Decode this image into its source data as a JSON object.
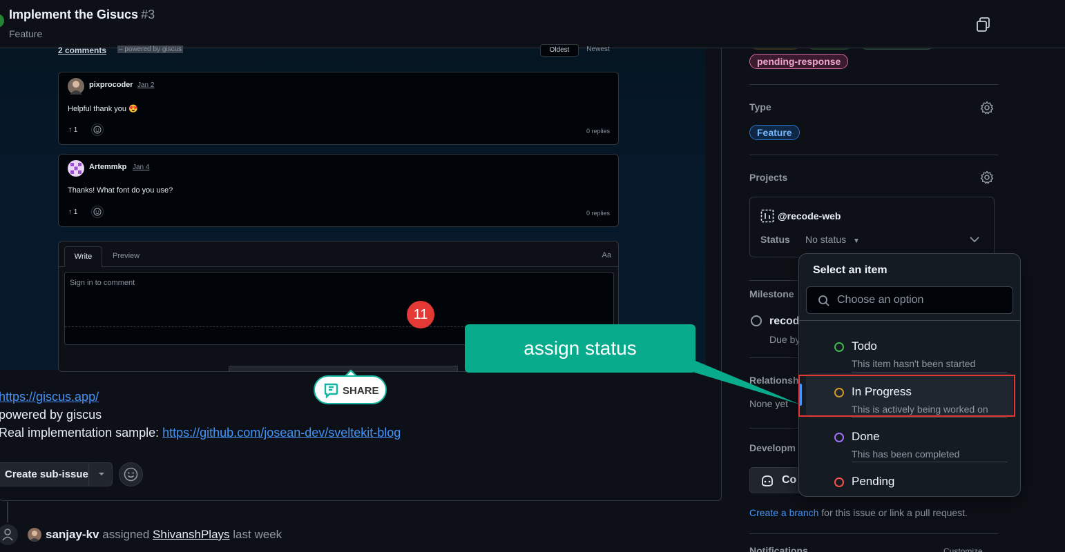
{
  "header": {
    "title": "Implement the Gisucs",
    "number": "#3",
    "type": "Feature"
  },
  "giscus": {
    "comments_count": "2 comments",
    "powered": "– powered by giscus",
    "sort_oldest": "Oldest",
    "sort_newest": "Newest",
    "comments": [
      {
        "author": "pixprocoder",
        "date": "Jan 2",
        "body": "Helpful thank you 😍",
        "votes": "1",
        "replies": "0 replies"
      },
      {
        "author": "Artemmkp",
        "date": "Jan 4",
        "body": "Thanks! What font do you use?",
        "votes": "1",
        "replies": "0 replies"
      }
    ],
    "editor": {
      "tab_write": "Write",
      "tab_preview": "Preview",
      "aa": "Aa",
      "placeholder": "Sign in to comment"
    }
  },
  "annotation": {
    "step": "11",
    "callout": "assign status",
    "share": "SHARE",
    "highlight_color": "#e53935",
    "callout_color": "#08ab8c"
  },
  "body": {
    "line1_link": "https://giscus.app/",
    "line2": "powered by giscus",
    "line3_prefix": "Real implementation sample: ",
    "line3_link": "https://github.com/josean-dev/sveltekit-blog"
  },
  "actions": {
    "create_sub_issue": "Create sub-issue"
  },
  "timeline": {
    "actor": "sanjay-kv",
    "verb": "assigned",
    "assignee": "ShivanshPlays",
    "time": "last week"
  },
  "sidebar": {
    "labels": {
      "pending": "pending-response"
    },
    "type": {
      "label": "Type",
      "value": "Feature"
    },
    "projects": {
      "label": "Projects",
      "name": "@recode-web",
      "status_label": "Status",
      "status_value": "No status"
    },
    "milestone": {
      "label": "Milestone",
      "name": "recod",
      "due": "Due by"
    },
    "relationships": {
      "label": "Relationsh",
      "value": "None yet"
    },
    "development": {
      "label": "Developm",
      "button": "Co",
      "create_branch": "Create a branch",
      "branch_suffix": " for this issue or link a pull request."
    },
    "notifications": {
      "label": "Notifications",
      "customize": "Customize"
    }
  },
  "dropdown": {
    "title": "Select an item",
    "placeholder": "Choose an option",
    "items": [
      {
        "name": "Todo",
        "desc": "This item hasn't been started",
        "color": "#3fb950"
      },
      {
        "name": "In Progress",
        "desc": "This is actively being worked on",
        "color": "#d29922"
      },
      {
        "name": "Done",
        "desc": "This has been completed",
        "color": "#a371f7"
      },
      {
        "name": "Pending",
        "desc": "",
        "color": "#f85149"
      }
    ]
  }
}
